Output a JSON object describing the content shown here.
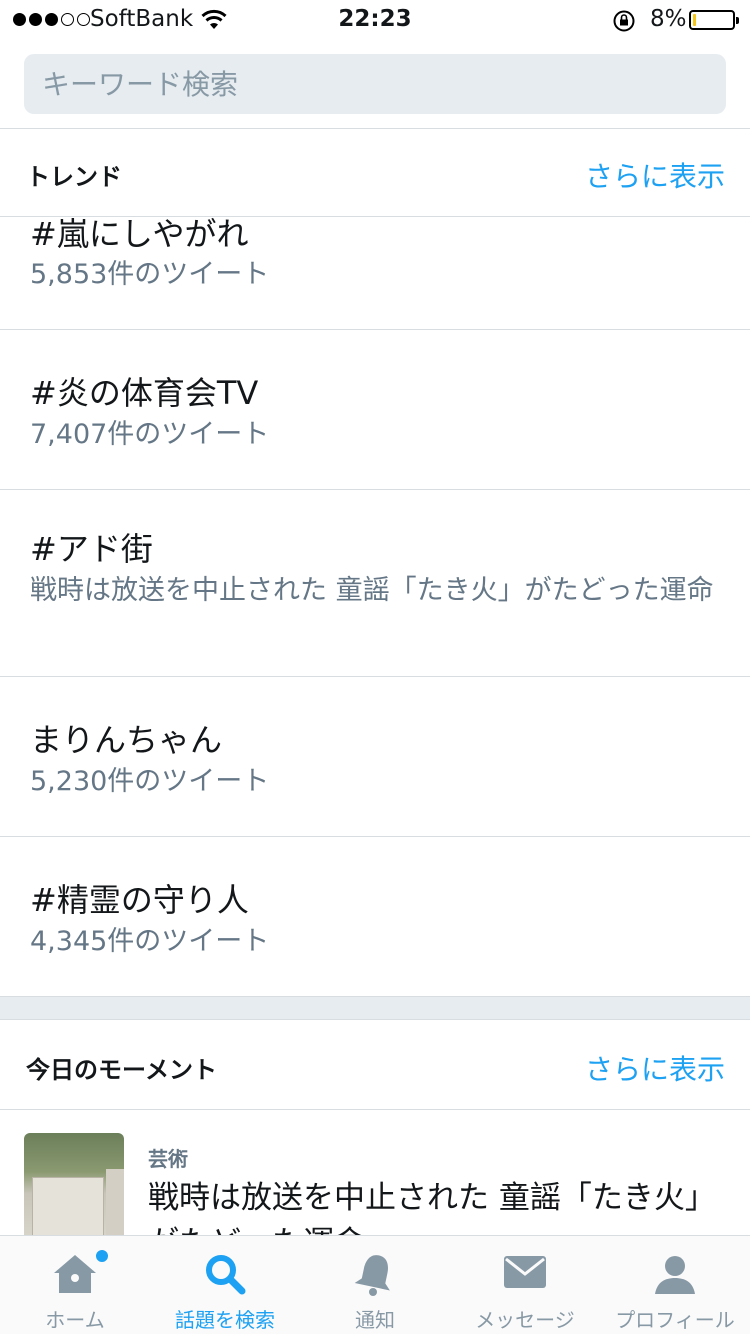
{
  "status_bar": {
    "carrier": "SoftBank",
    "time": "22:23",
    "battery_percent": "8%",
    "battery_level": 0.08,
    "signal_bars_filled": 3,
    "signal_bars_total": 5
  },
  "search": {
    "placeholder": "キーワード検索"
  },
  "trends": {
    "title": "トレンド",
    "more": "さらに表示",
    "items": [
      {
        "title": "#嵐にしやがれ",
        "sub": "5,853件のツイート"
      },
      {
        "title": "#炎の体育会TV",
        "sub": "7,407件のツイート"
      },
      {
        "title": "#アド街",
        "sub": "戦時は放送を中止された 童謡「たき火」がたどった運命"
      },
      {
        "title": "まりんちゃん",
        "sub": "5,230件のツイート"
      },
      {
        "title": "#精霊の守り人",
        "sub": "4,345件のツイート"
      }
    ]
  },
  "moments": {
    "title": "今日のモーメント",
    "more": "さらに表示",
    "item": {
      "category": "芸術",
      "title": "戦時は放送を中止された 童謡「たき火」がたどった運命"
    }
  },
  "tabs": [
    {
      "label": "ホーム",
      "icon": "home-icon"
    },
    {
      "label": "話題を検索",
      "icon": "search-icon"
    },
    {
      "label": "通知",
      "icon": "bell-icon"
    },
    {
      "label": "メッセージ",
      "icon": "envelope-icon"
    },
    {
      "label": "プロフィール",
      "icon": "person-icon"
    }
  ],
  "colors": {
    "accent": "#1da1f2",
    "secondary_text": "#657786",
    "search_bg": "#e6ecf0"
  }
}
